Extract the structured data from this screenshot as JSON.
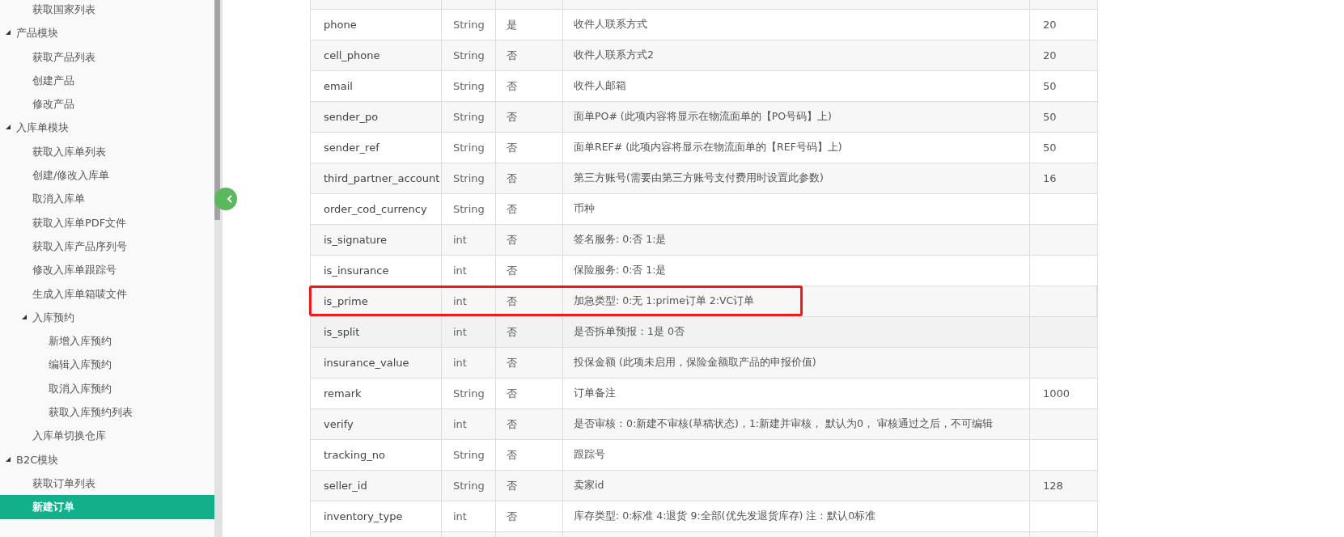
{
  "sidebar": {
    "items": [
      {
        "children": [
          {
            "label": "获取国家列表",
            "selected": false
          }
        ]
      },
      {
        "label": "产品模块",
        "expanded": true,
        "children": [
          {
            "label": "获取产品列表",
            "selected": false
          },
          {
            "label": "创建产品",
            "selected": false
          },
          {
            "label": "修改产品",
            "selected": false
          }
        ]
      },
      {
        "label": "入库单模块",
        "expanded": true,
        "children": [
          {
            "label": "获取入库单列表",
            "selected": false
          },
          {
            "label": "创建/修改入库单",
            "selected": false
          },
          {
            "label": "取消入库单",
            "selected": false
          },
          {
            "label": "获取入库单PDF文件",
            "selected": false
          },
          {
            "label": "获取入库产品序列号",
            "selected": false
          },
          {
            "label": "修改入库单跟踪号",
            "selected": false
          },
          {
            "label": "生成入库单箱唛文件",
            "selected": false
          },
          {
            "label": "入库预约",
            "expanded": true,
            "children": [
              {
                "label": "新增入库预约",
                "selected": false
              },
              {
                "label": "编辑入库预约",
                "selected": false
              },
              {
                "label": "取消入库预约",
                "selected": false
              },
              {
                "label": "获取入库预约列表",
                "selected": false
              }
            ]
          },
          {
            "label": "入库单切换仓库",
            "selected": false
          }
        ]
      },
      {
        "label": "B2C模块",
        "expanded": true,
        "children": [
          {
            "label": "获取订单列表",
            "selected": false
          },
          {
            "label": "新建订单",
            "selected": true
          }
        ]
      }
    ]
  },
  "table": {
    "rows": [
      {
        "cells": [
          "phone",
          "String",
          "是",
          "收件人联系方式",
          "20"
        ],
        "hovered": false,
        "highlighted": false
      },
      {
        "cells": [
          "cell_phone",
          "String",
          "否",
          "收件人联系方式2",
          "20"
        ],
        "hovered": false,
        "highlighted": false
      },
      {
        "cells": [
          "email",
          "String",
          "否",
          "收件人邮箱",
          "50"
        ],
        "hovered": false,
        "highlighted": false
      },
      {
        "cells": [
          "sender_po",
          "String",
          "否",
          "面单PO# (此项内容将显示在物流面单的【PO号码】上)",
          "50"
        ],
        "hovered": false,
        "highlighted": false
      },
      {
        "cells": [
          "sender_ref",
          "String",
          "否",
          "面单REF# (此项内容将显示在物流面单的【REF号码】上)",
          "50"
        ],
        "hovered": false,
        "highlighted": false
      },
      {
        "cells": [
          "third_partner_account",
          "String",
          "否",
          "第三方账号(需要由第三方账号支付费用时设置此参数)",
          "16"
        ],
        "hovered": false,
        "highlighted": false
      },
      {
        "cells": [
          "order_cod_currency",
          "String",
          "否",
          "币种",
          ""
        ],
        "hovered": false,
        "highlighted": false
      },
      {
        "cells": [
          "is_signature",
          "int",
          "否",
          "签名服务: 0:否 1:是",
          ""
        ],
        "hovered": false,
        "highlighted": false
      },
      {
        "cells": [
          "is_insurance",
          "int",
          "否",
          "保险服务: 0:否 1:是",
          ""
        ],
        "hovered": false,
        "highlighted": false
      },
      {
        "cells": [
          "is_prime",
          "int",
          "否",
          "加急类型: 0:无 1:prime订单 2:VC订单",
          ""
        ],
        "hovered": false,
        "highlighted": true
      },
      {
        "cells": [
          "is_split",
          "int",
          "否",
          "是否拆单预报：1是 0否",
          ""
        ],
        "hovered": true,
        "highlighted": false
      },
      {
        "cells": [
          "insurance_value",
          "int",
          "否",
          "投保金额 (此项未启用，保险金额取产品的申报价值)",
          ""
        ],
        "hovered": false,
        "highlighted": false
      },
      {
        "cells": [
          "remark",
          "String",
          "否",
          "订单备注",
          "1000"
        ],
        "hovered": false,
        "highlighted": false
      },
      {
        "cells": [
          "verify",
          "int",
          "否",
          "是否审核：0:新建不审核(草稿状态)，1:新建并审核， 默认为0， 审核通过之后，不可编辑",
          ""
        ],
        "hovered": false,
        "highlighted": false
      },
      {
        "cells": [
          "tracking_no",
          "String",
          "否",
          "跟踪号",
          ""
        ],
        "hovered": false,
        "highlighted": false
      },
      {
        "cells": [
          "seller_id",
          "String",
          "否",
          "卖家id",
          "128"
        ],
        "hovered": false,
        "highlighted": false
      },
      {
        "cells": [
          "inventory_type",
          "int",
          "否",
          "库存类型: 0:标准 4:退货 9:全部(优先发退货库存) 注：默认0标准",
          ""
        ],
        "hovered": false,
        "highlighted": false
      }
    ]
  }
}
